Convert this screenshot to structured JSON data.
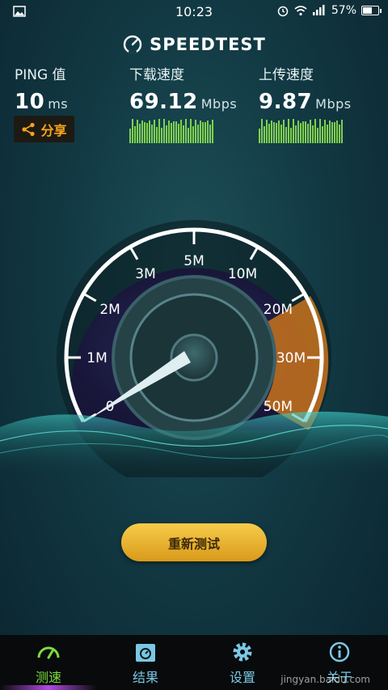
{
  "status_bar": {
    "time": "10:23",
    "battery": "57%"
  },
  "app": {
    "title": "SPEEDTEST"
  },
  "stats": {
    "ping": {
      "label": "PING 值",
      "value": "10",
      "unit": "ms"
    },
    "download": {
      "label": "下载速度",
      "value": "69.12",
      "unit": "Mbps"
    },
    "upload": {
      "label": "上传速度",
      "value": "9.87",
      "unit": "Mbps"
    }
  },
  "share": {
    "label": "分享",
    "icon": "share-icon"
  },
  "gauge": {
    "ticks": [
      "0",
      "1M",
      "2M",
      "3M",
      "5M",
      "10M",
      "20M",
      "30M",
      "50M"
    ]
  },
  "retest": {
    "label": "重新测试"
  },
  "nav": {
    "items": [
      {
        "label": "测速",
        "icon": "speedometer-icon"
      },
      {
        "label": "结果",
        "icon": "results-icon"
      },
      {
        "label": "设置",
        "icon": "gear-icon"
      },
      {
        "label": "关于",
        "icon": "info-icon"
      }
    ]
  },
  "watermark": "jingyan.baidu.com",
  "colors": {
    "accent_green": "#7bdc3e",
    "accent_orange": "#f6a51b",
    "nav_blue": "#7ac7e4"
  }
}
